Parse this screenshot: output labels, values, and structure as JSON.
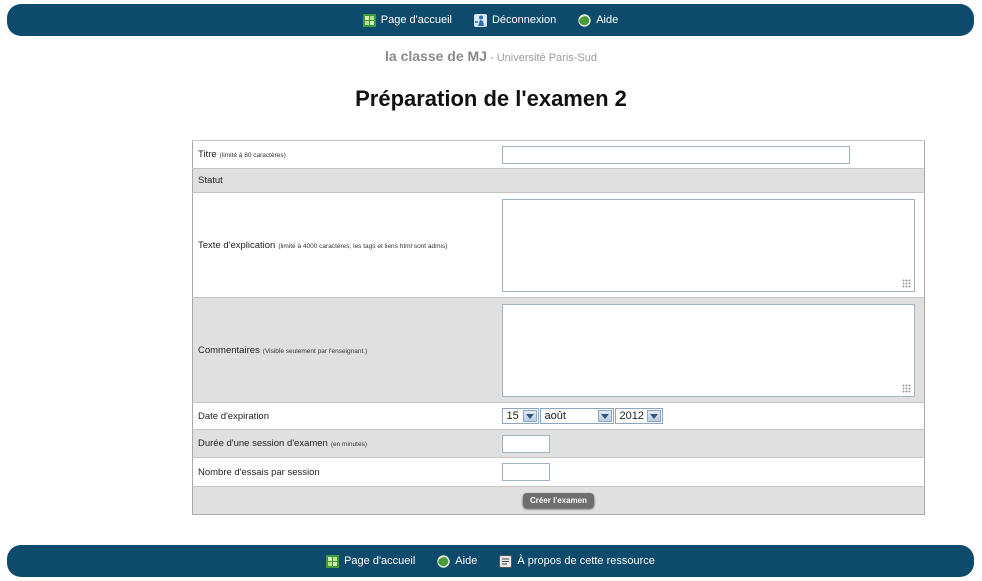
{
  "nav_top": [
    {
      "label": "Page d'accueil",
      "icon": "home-icon"
    },
    {
      "label": "Déconnexion",
      "icon": "logout-icon"
    },
    {
      "label": "Aide",
      "icon": "help-icon"
    }
  ],
  "site": {
    "class_name": "la classe de MJ",
    "institution": "- Université Paris-Sud"
  },
  "page_title": "Préparation de l'examen 2",
  "form": {
    "titre": {
      "label": "Titre",
      "hint": "(limité à 80 caractères)",
      "value": ""
    },
    "statut": {
      "label": "Statut"
    },
    "texte": {
      "label": "Texte d'explication",
      "hint": "(limité à 4000 caractères; les tags et liens html sont admis)",
      "value": ""
    },
    "commentaires": {
      "label": "Commentaires",
      "hint": "(Visible seulement par l'enseignant.)",
      "value": ""
    },
    "date": {
      "label": "Date d'expiration",
      "day": "15",
      "month": "août",
      "year": "2012"
    },
    "duree": {
      "label": "Durée d'une session d'examen",
      "hint": "(en minutes)",
      "value": ""
    },
    "essais": {
      "label": "Nombre d'essais par session",
      "value": ""
    },
    "submit_label": "Créer l'examen"
  },
  "nav_bottom": [
    {
      "label": "Page d'accueil",
      "icon": "home-icon"
    },
    {
      "label": "Aide",
      "icon": "help-icon"
    },
    {
      "label": "À propos de cette ressource",
      "icon": "document-icon"
    }
  ]
}
